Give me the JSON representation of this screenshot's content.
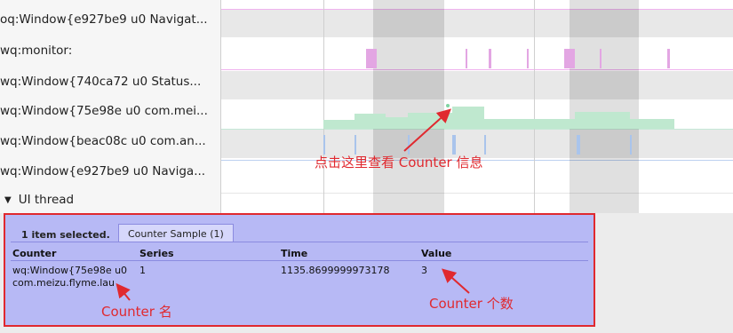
{
  "tracks": [
    {
      "label": "oq:Window{e927be9 u0 Navigat..."
    },
    {
      "label": "wq:monitor:"
    },
    {
      "label": "wq:Window{740ca72 u0 Status..."
    },
    {
      "label": "wq:Window{75e98e u0 com.mei..."
    },
    {
      "label": "wq:Window{beac08c u0 com.an..."
    },
    {
      "label": "wq:Window{e927be9 u0 Naviga..."
    }
  ],
  "ui_thread": {
    "toggle": "▼",
    "label": "UI thread"
  },
  "panel": {
    "status": "1 item selected.",
    "tab": "Counter Sample (1)",
    "columns": [
      "Counter",
      "Series",
      "Time",
      "Value"
    ],
    "row": {
      "counter_line1": "wq:Window{75e98e u0",
      "counter_line2": "com.meizu.flyme.lau",
      "series": "1",
      "time": "1135.8699999973178",
      "value": "3"
    }
  },
  "annotations": {
    "view_counter": "点击这里查看 Counter 信息",
    "counter_name": "Counter 名",
    "counter_count": "Counter 个数"
  },
  "colors": {
    "highlight_border": "#e0292f",
    "panel_bg": "#b7b9f5",
    "track_pink": "#e3a6e3",
    "track_green": "#bfe8cf",
    "track_blue": "#a9c4ec"
  }
}
